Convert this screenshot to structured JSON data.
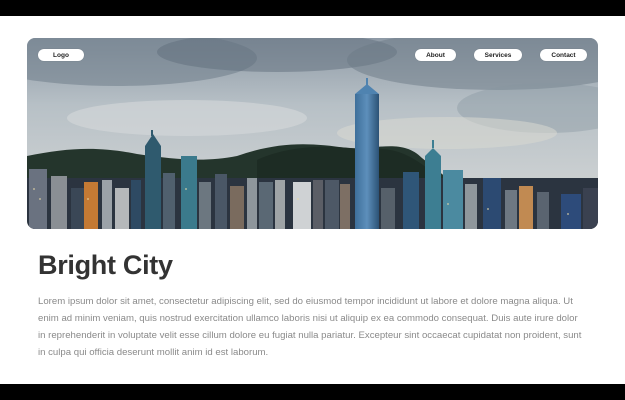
{
  "nav": {
    "logo_label": "Logo",
    "items": [
      {
        "label": "About"
      },
      {
        "label": "Services"
      },
      {
        "label": "Contact"
      }
    ]
  },
  "main": {
    "title": "Bright City",
    "body": "Lorem ipsum dolor sit amet, consectetur adipiscing elit, sed do eiusmod tempor incididunt ut labore et dolore magna aliqua. Ut enim ad minim veniam, quis nostrud exercitation ullamco laboris nisi ut aliquip ex ea commodo consequat. Duis aute irure dolor in reprehenderit in voluptate velit esse cillum dolore eu fugiat nulla pariatur. Excepteur sint occaecat cupidatat non proident, sunt in culpa qui officia deserunt mollit anim id est laborum."
  },
  "colors": {
    "page_background": "#ffffff",
    "frame": "#000000",
    "title": "#333333",
    "body_text": "#8a8a8a",
    "nav_pill": "#ffffff"
  }
}
